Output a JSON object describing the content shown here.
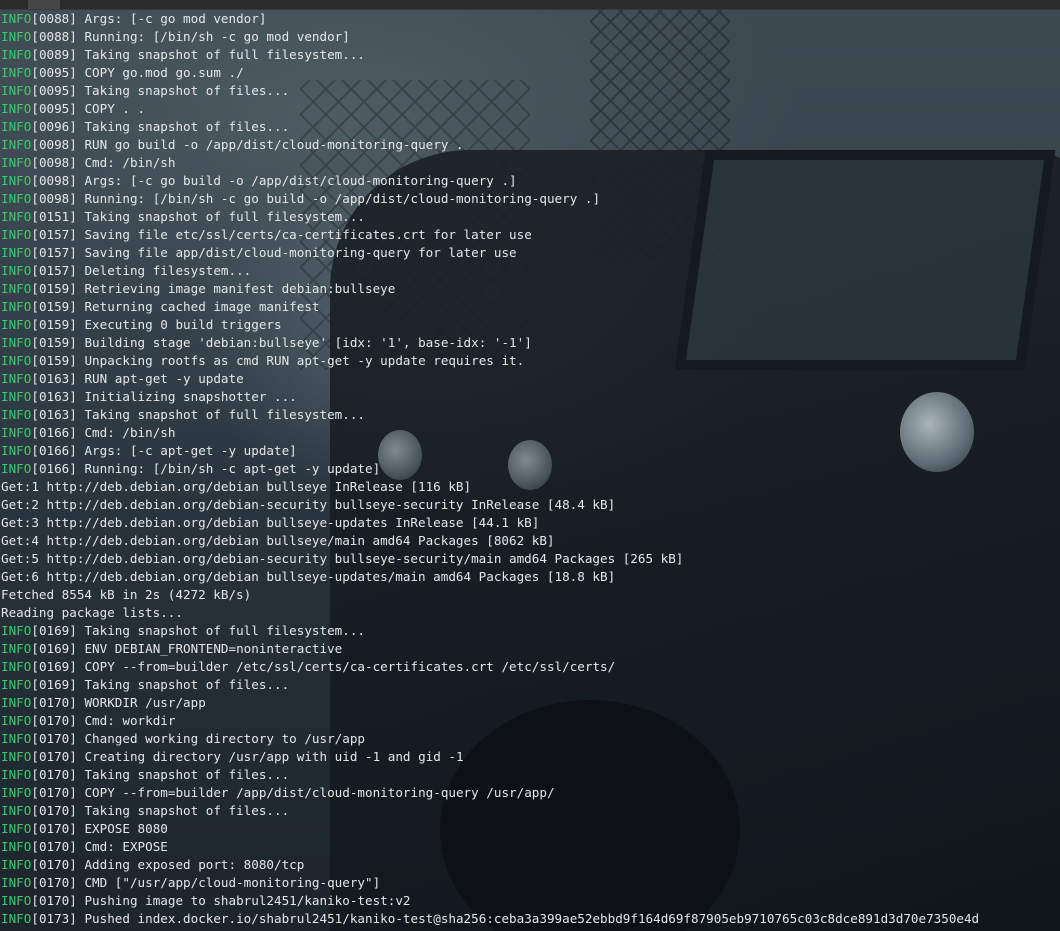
{
  "window": {
    "accent_colors": {
      "info_level": "#3ccb6a",
      "text": "#e4e7e9",
      "background": "#26313a"
    }
  },
  "log": {
    "lines": [
      {
        "level": "INFO",
        "time": "0088",
        "message": " Args: [-c go mod vendor]"
      },
      {
        "level": "INFO",
        "time": "0088",
        "message": " Running: [/bin/sh -c go mod vendor]"
      },
      {
        "level": "INFO",
        "time": "0089",
        "message": " Taking snapshot of full filesystem..."
      },
      {
        "level": "INFO",
        "time": "0095",
        "message": " COPY go.mod go.sum ./"
      },
      {
        "level": "INFO",
        "time": "0095",
        "message": " Taking snapshot of files..."
      },
      {
        "level": "INFO",
        "time": "0095",
        "message": " COPY . ."
      },
      {
        "level": "INFO",
        "time": "0096",
        "message": " Taking snapshot of files..."
      },
      {
        "level": "INFO",
        "time": "0098",
        "message": " RUN go build -o /app/dist/cloud-monitoring-query ."
      },
      {
        "level": "INFO",
        "time": "0098",
        "message": " Cmd: /bin/sh"
      },
      {
        "level": "INFO",
        "time": "0098",
        "message": " Args: [-c go build -o /app/dist/cloud-monitoring-query .]"
      },
      {
        "level": "INFO",
        "time": "0098",
        "message": " Running: [/bin/sh -c go build -o /app/dist/cloud-monitoring-query .]"
      },
      {
        "level": "INFO",
        "time": "0151",
        "message": " Taking snapshot of full filesystem..."
      },
      {
        "level": "INFO",
        "time": "0157",
        "message": " Saving file etc/ssl/certs/ca-certificates.crt for later use"
      },
      {
        "level": "INFO",
        "time": "0157",
        "message": " Saving file app/dist/cloud-monitoring-query for later use"
      },
      {
        "level": "INFO",
        "time": "0157",
        "message": " Deleting filesystem..."
      },
      {
        "level": "INFO",
        "time": "0159",
        "message": " Retrieving image manifest debian:bullseye"
      },
      {
        "level": "INFO",
        "time": "0159",
        "message": " Returning cached image manifest"
      },
      {
        "level": "INFO",
        "time": "0159",
        "message": " Executing 0 build triggers"
      },
      {
        "level": "INFO",
        "time": "0159",
        "message": " Building stage 'debian:bullseye' [idx: '1', base-idx: '-1']"
      },
      {
        "level": "INFO",
        "time": "0159",
        "message": " Unpacking rootfs as cmd RUN apt-get -y update requires it."
      },
      {
        "level": "INFO",
        "time": "0163",
        "message": " RUN apt-get -y update"
      },
      {
        "level": "INFO",
        "time": "0163",
        "message": " Initializing snapshotter ..."
      },
      {
        "level": "INFO",
        "time": "0163",
        "message": " Taking snapshot of full filesystem..."
      },
      {
        "level": "INFO",
        "time": "0166",
        "message": " Cmd: /bin/sh"
      },
      {
        "level": "INFO",
        "time": "0166",
        "message": " Args: [-c apt-get -y update]"
      },
      {
        "level": "INFO",
        "time": "0166",
        "message": " Running: [/bin/sh -c apt-get -y update]"
      },
      {
        "level": "",
        "time": "",
        "message": "Get:1 http://deb.debian.org/debian bullseye InRelease [116 kB]"
      },
      {
        "level": "",
        "time": "",
        "message": "Get:2 http://deb.debian.org/debian-security bullseye-security InRelease [48.4 kB]"
      },
      {
        "level": "",
        "time": "",
        "message": "Get:3 http://deb.debian.org/debian bullseye-updates InRelease [44.1 kB]"
      },
      {
        "level": "",
        "time": "",
        "message": "Get:4 http://deb.debian.org/debian bullseye/main amd64 Packages [8062 kB]"
      },
      {
        "level": "",
        "time": "",
        "message": "Get:5 http://deb.debian.org/debian-security bullseye-security/main amd64 Packages [265 kB]"
      },
      {
        "level": "",
        "time": "",
        "message": "Get:6 http://deb.debian.org/debian bullseye-updates/main amd64 Packages [18.8 kB]"
      },
      {
        "level": "",
        "time": "",
        "message": "Fetched 8554 kB in 2s (4272 kB/s)"
      },
      {
        "level": "",
        "time": "",
        "message": "Reading package lists..."
      },
      {
        "level": "INFO",
        "time": "0169",
        "message": " Taking snapshot of full filesystem..."
      },
      {
        "level": "INFO",
        "time": "0169",
        "message": " ENV DEBIAN_FRONTEND=noninteractive"
      },
      {
        "level": "INFO",
        "time": "0169",
        "message": " COPY --from=builder /etc/ssl/certs/ca-certificates.crt /etc/ssl/certs/"
      },
      {
        "level": "INFO",
        "time": "0169",
        "message": " Taking snapshot of files..."
      },
      {
        "level": "INFO",
        "time": "0170",
        "message": " WORKDIR /usr/app"
      },
      {
        "level": "INFO",
        "time": "0170",
        "message": " Cmd: workdir"
      },
      {
        "level": "INFO",
        "time": "0170",
        "message": " Changed working directory to /usr/app"
      },
      {
        "level": "INFO",
        "time": "0170",
        "message": " Creating directory /usr/app with uid -1 and gid -1"
      },
      {
        "level": "INFO",
        "time": "0170",
        "message": " Taking snapshot of files..."
      },
      {
        "level": "INFO",
        "time": "0170",
        "message": " COPY --from=builder /app/dist/cloud-monitoring-query /usr/app/"
      },
      {
        "level": "INFO",
        "time": "0170",
        "message": " Taking snapshot of files..."
      },
      {
        "level": "INFO",
        "time": "0170",
        "message": " EXPOSE 8080"
      },
      {
        "level": "INFO",
        "time": "0170",
        "message": " Cmd: EXPOSE"
      },
      {
        "level": "INFO",
        "time": "0170",
        "message": " Adding exposed port: 8080/tcp"
      },
      {
        "level": "INFO",
        "time": "0170",
        "message": " CMD [\"/usr/app/cloud-monitoring-query\"]"
      },
      {
        "level": "INFO",
        "time": "0170",
        "message": " Pushing image to shabrul2451/kaniko-test:v2"
      },
      {
        "level": "INFO",
        "time": "0173",
        "message": " Pushed index.docker.io/shabrul2451/kaniko-test@sha256:ceba3a399ae52ebbd9f164d69f87905eb9710765c03c8dce891d3d70e7350e4d"
      }
    ]
  }
}
